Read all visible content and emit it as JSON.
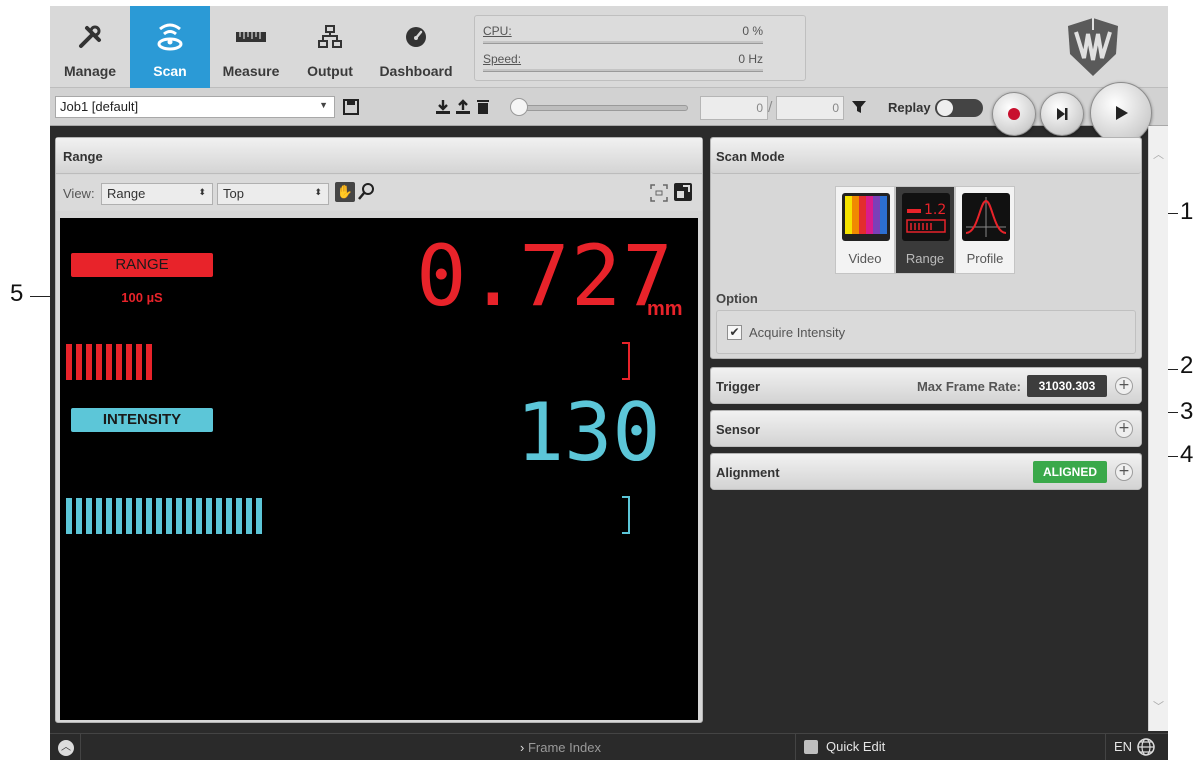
{
  "nav": {
    "items": [
      {
        "label": "Manage",
        "icon": "wrench-screwdriver-icon"
      },
      {
        "label": "Scan",
        "icon": "scan-sensor-icon"
      },
      {
        "label": "Measure",
        "icon": "ruler-icon"
      },
      {
        "label": "Output",
        "icon": "network-icon"
      },
      {
        "label": "Dashboard",
        "icon": "gauge-icon"
      }
    ],
    "active": "Scan",
    "active_color": "#2b9ad6"
  },
  "stats": {
    "cpu_label": "CPU:",
    "cpu_value": "0 %",
    "speed_label": "Speed:",
    "speed_value": "0 Hz"
  },
  "toolbar": {
    "job": "Job1 [default]",
    "frame_current": "0",
    "frame_separator": "/",
    "frame_total": "0",
    "replay_label": "Replay"
  },
  "range_panel": {
    "title": "Range",
    "view_label": "View:",
    "view_select": "Range",
    "view_dir_select": "Top",
    "display": {
      "range_badge": "RANGE",
      "range_exposure": "100 µS",
      "range_value": "0.727",
      "range_unit": "mm",
      "range_bar_count": 9,
      "intensity_badge": "INTENSITY",
      "intensity_value": "130",
      "intensity_bar_count": 20,
      "range_color": "#e8232a",
      "intensity_color": "#5cc6d8"
    }
  },
  "scan_mode": {
    "title": "Scan Mode",
    "modes": [
      {
        "label": "Video",
        "icon": "video-bars-icon"
      },
      {
        "label": "Range",
        "icon": "range-display-icon"
      },
      {
        "label": "Profile",
        "icon": "profile-curve-icon"
      }
    ],
    "selected": "Range",
    "option_label": "Option",
    "acquire_intensity_label": "Acquire Intensity",
    "acquire_intensity_checked": true
  },
  "trigger": {
    "title": "Trigger",
    "max_frame_rate_label": "Max Frame Rate:",
    "max_frame_rate_value": "31030.303"
  },
  "sensor": {
    "title": "Sensor"
  },
  "alignment": {
    "title": "Alignment",
    "status": "ALIGNED",
    "status_color": "#3aa94a"
  },
  "statusbar": {
    "frame_index": "Frame Index",
    "quick_edit": "Quick Edit",
    "language": "EN"
  },
  "callouts": [
    "1",
    "2",
    "3",
    "4",
    "5"
  ]
}
